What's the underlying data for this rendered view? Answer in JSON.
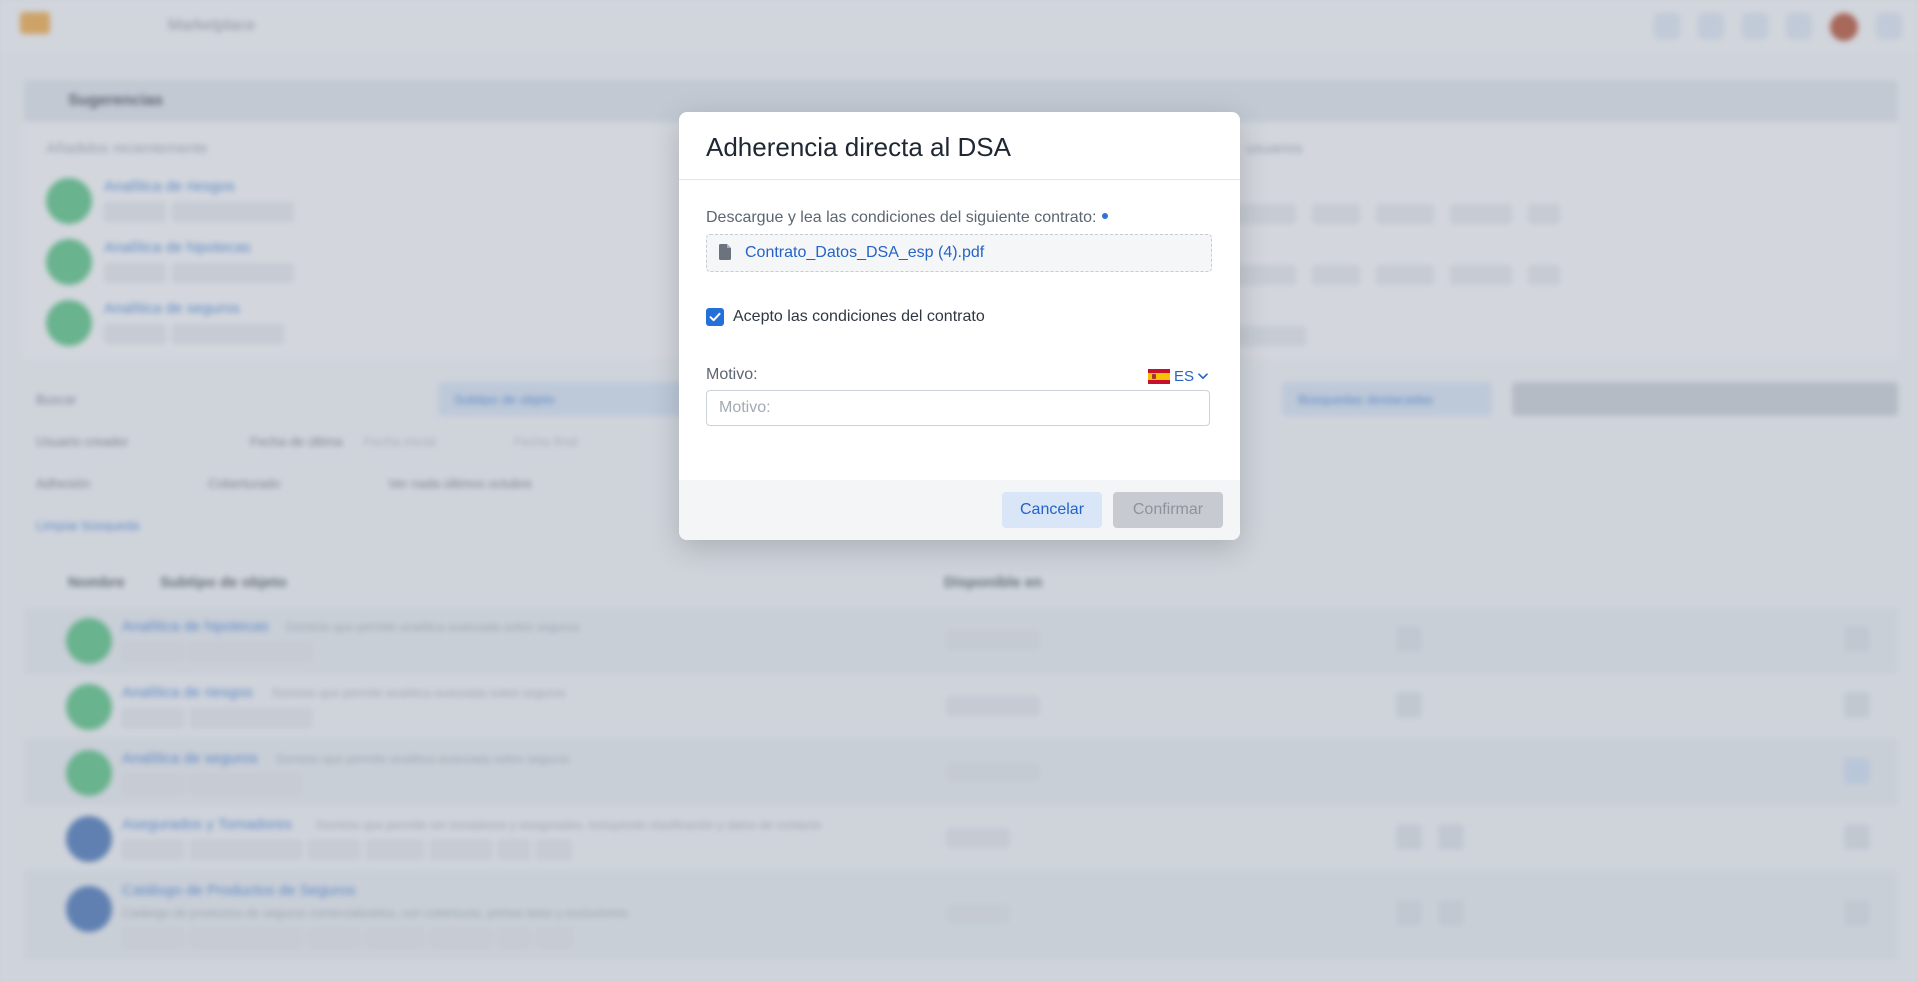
{
  "app": {
    "name": "Marketplace"
  },
  "suggestions": {
    "title": "Sugerencias",
    "recent_title": "Añadidos recientemente",
    "users_title": "usuarios",
    "recent_items": [
      {
        "name": "Analítica de riesgos"
      },
      {
        "name": "Analítica de hipotecas"
      },
      {
        "name": "Analítica de seguros"
      }
    ]
  },
  "filters": {
    "search_label": "Buscar",
    "subtype_label": "Subtipo de objeto",
    "created_user_label": "Usuario creador",
    "date_label": "Fecha de última",
    "start_date_placeholder": "Fecha inicial",
    "end_date_placeholder": "Fecha final",
    "adhesion_label": "Adhesión",
    "coberturado_label": "Coberturado",
    "not_viewed_label": "Ver nada últimos octubre",
    "clear_search": "Limpiar búsqueda",
    "featured_search": "Búsquedas destacadas"
  },
  "table": {
    "col_name": "Nombre",
    "col_subtype": "Subtipo de objeto",
    "col_available": "Disponible en",
    "rows": [
      {
        "name": "Analítica de hipotecas",
        "desc": "Dominio que permite analítica avanzada sobre seguros"
      },
      {
        "name": "Analítica de riesgos",
        "desc": "Dominio que permite analítica avanzada sobre seguros"
      },
      {
        "name": "Analítica de seguros",
        "desc": "Dominio que permite analítica avanzada sobre seguros"
      },
      {
        "name": "Asegurados y Tomadores",
        "desc": "Dominio que permite ver tomadores y asegurados, incluyendo clasificación y datos de contacto"
      },
      {
        "name": "Catálogo de Productos de Seguros",
        "desc": "Catálogo de productos de seguros comercializados, con coberturas, primas base y exclusiones"
      }
    ]
  },
  "modal": {
    "title": "Adherencia directa al DSA",
    "contract_label": "Descargue y lea las condiciones del siguiente contrato:",
    "file_name": "Contrato_Datos_DSA_esp (4).pdf",
    "accept_label": "Acepto las condiciones del contrato",
    "accept_checked": true,
    "reason_label": "Motivo:",
    "reason_placeholder": "Motivo:",
    "reason_value": "",
    "language_code": "ES",
    "cancel_label": "Cancelar",
    "confirm_label": "Confirmar",
    "accent_color": "#2370d8"
  }
}
